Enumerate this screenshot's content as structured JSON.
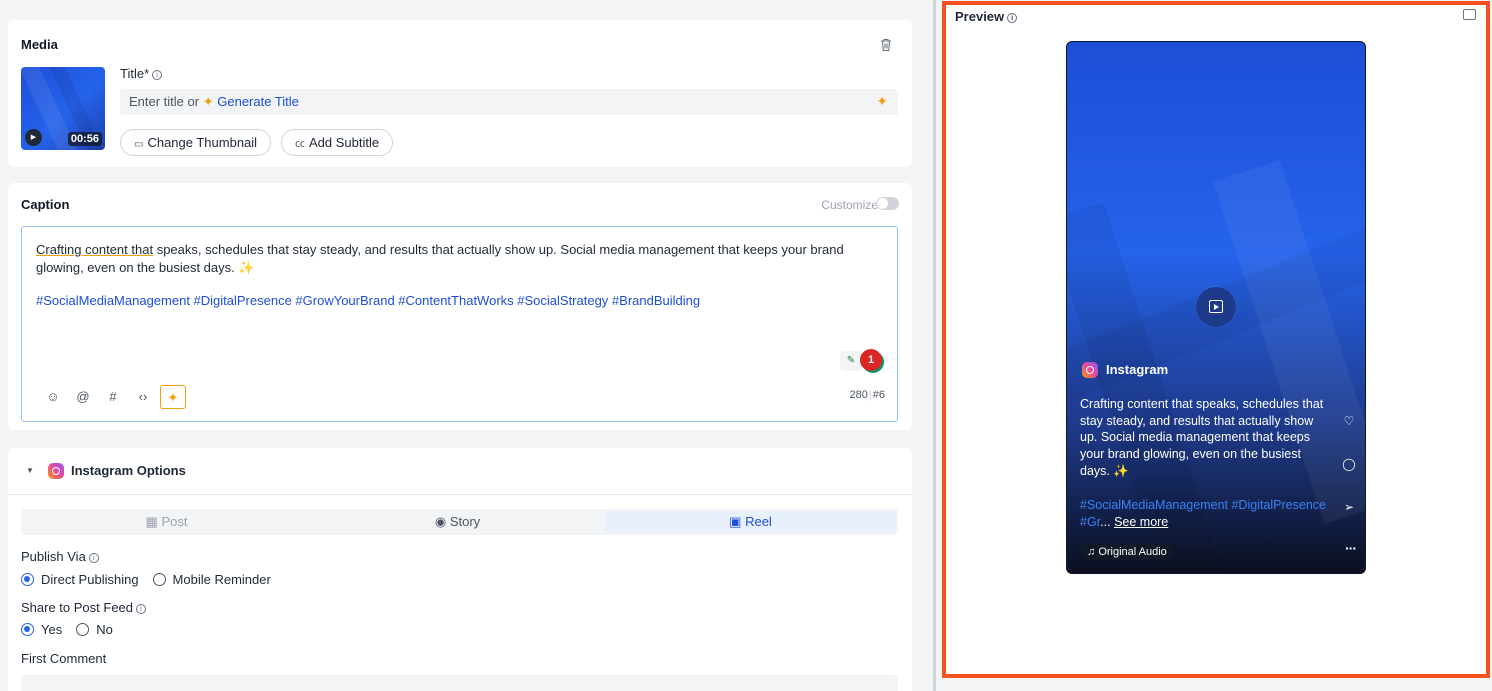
{
  "media": {
    "heading": "Media",
    "duration": "00:56",
    "title_label": "Title*",
    "title_placeholder": "Enter title or",
    "generate_title": "Generate Title",
    "change_thumbnail": "Change Thumbnail",
    "add_subtitle": "Add Subtitle"
  },
  "caption": {
    "heading": "Caption",
    "customize_label": "Customize",
    "text_underlined": "Crafting content that",
    "text_rest": " speaks, schedules that stay steady, and results that actually show up. Social media management that keeps your brand glowing, even on the busiest days. ✨",
    "hashtags": "#SocialMediaManagement #DigitalPresence #GrowYourBrand #ContentThatWorks #SocialStrategy #BrandBuilding",
    "grammar_count": "1",
    "char_count": "280",
    "hashtag_count": "#6"
  },
  "instagram_options": {
    "heading": "Instagram Options",
    "tabs": [
      {
        "label": "Post",
        "state": "disabled"
      },
      {
        "label": "Story",
        "state": "normal"
      },
      {
        "label": "Reel",
        "state": "active"
      }
    ],
    "publish_via_label": "Publish Via",
    "publish_options": [
      "Direct Publishing",
      "Mobile Reminder"
    ],
    "publish_selected": "Direct Publishing",
    "share_feed_label": "Share to Post Feed",
    "share_options": [
      "Yes",
      "No"
    ],
    "share_selected": "Yes",
    "first_comment_label": "First Comment"
  },
  "preview": {
    "heading": "Preview",
    "account": "Instagram",
    "caption": "Crafting content that speaks, schedules that stay steady, and results that actually show up. Social media management that keeps your brand glowing, even on the busiest days. ✨",
    "tags_line1": "#SocialMediaManagement #DigitalPresence",
    "tags_line2": "#Gr",
    "see_more": "See more",
    "audio": "Original Audio"
  },
  "colors": {
    "accent": "#2563eb",
    "preview_border": "#f4511e",
    "ai_spark": "#f59e0b"
  }
}
